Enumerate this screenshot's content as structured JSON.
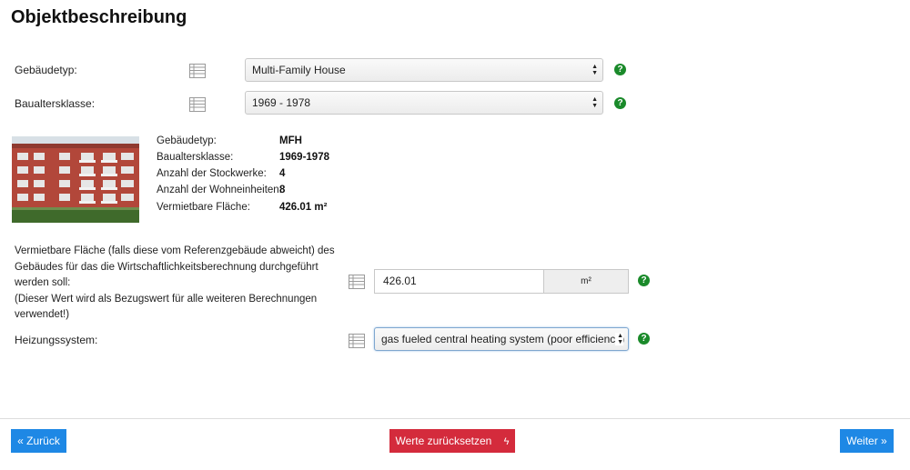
{
  "page": {
    "title": "Objektbeschreibung"
  },
  "building_type": {
    "label": "Gebäudetyp:",
    "selected": "Multi-Family House"
  },
  "age_class": {
    "label": "Baualtersklasse:",
    "selected": "1969 - 1978"
  },
  "summary": {
    "rows": [
      {
        "key": "Gebäudetyp:",
        "value": "MFH"
      },
      {
        "key": "Baualtersklasse:",
        "value": "1969-1978"
      },
      {
        "key": "Anzahl der Stockwerke:",
        "value": "4"
      },
      {
        "key": "Anzahl der Wohneinheiten:",
        "value": "8"
      },
      {
        "key": "Vermietbare Fläche:",
        "value": "426.01 m²"
      }
    ]
  },
  "area": {
    "description": "Vermietbare Fläche (falls diese vom Referenzgebäude abweicht) des Gebäudes für das die Wirtschaftlichkeitsberechnung durchgeführt werden soll:\n(Dieser Wert wird als Bezugswert für alle weiteren Berechnungen verwendet!)",
    "value": "426.01",
    "unit": "m²"
  },
  "heating": {
    "label": "Heizungssystem:",
    "selected": "gas fueled central heating system (poor efficiency)"
  },
  "help_glyph": "?",
  "footer": {
    "back_label": "« Zurück",
    "reset_label": "Werte zurücksetzen",
    "reset_icon_glyph": "ϟ",
    "next_label": "Weiter »"
  },
  "colors": {
    "help": "#1a8a2a",
    "primary": "#1e88e5",
    "danger": "#d42b3c"
  },
  "icons": [
    "table-icon",
    "help-icon",
    "chevron-updown-icon",
    "lightning-icon"
  ]
}
